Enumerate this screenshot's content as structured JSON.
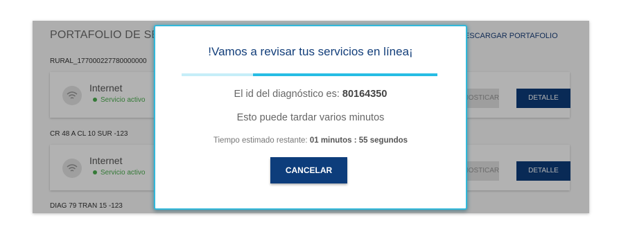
{
  "background": {
    "title": "PORTAFOLIO DE SERVICIOS",
    "download_link": "DESCARGAR PORTAFOLIO",
    "locations": [
      {
        "address": "RURAL_177000227780000000",
        "service": {
          "name": "Internet",
          "status": "Servicio activo",
          "secondary_button": "DIAGNOSTICAR",
          "detail_button": "DETALLE"
        }
      },
      {
        "address": "CR 48 A CL 10 SUR -123",
        "service": {
          "name": "Internet",
          "status": "Servicio activo",
          "secondary_button": "DIAGNOSTICAR",
          "detail_button": "DETALLE"
        }
      },
      {
        "address": "DIAG 79 TRAN 15 -123"
      }
    ]
  },
  "modal": {
    "title": "!Vamos a revisar tus servicios en línea¡",
    "progress_fraction": 0.28,
    "diagnostic_label": "El id del diagnóstico es:",
    "diagnostic_id": "80164350",
    "wait_message": "Esto puede tardar varios minutos",
    "remaining_label": "Tiempo estimado restante:",
    "remaining_time": "01 minutos : 55 segundos",
    "cancel_label": "CANCELAR"
  },
  "colors": {
    "accent": "#27bde4",
    "primary": "#0d3d7b",
    "status_active": "#4caf50"
  }
}
